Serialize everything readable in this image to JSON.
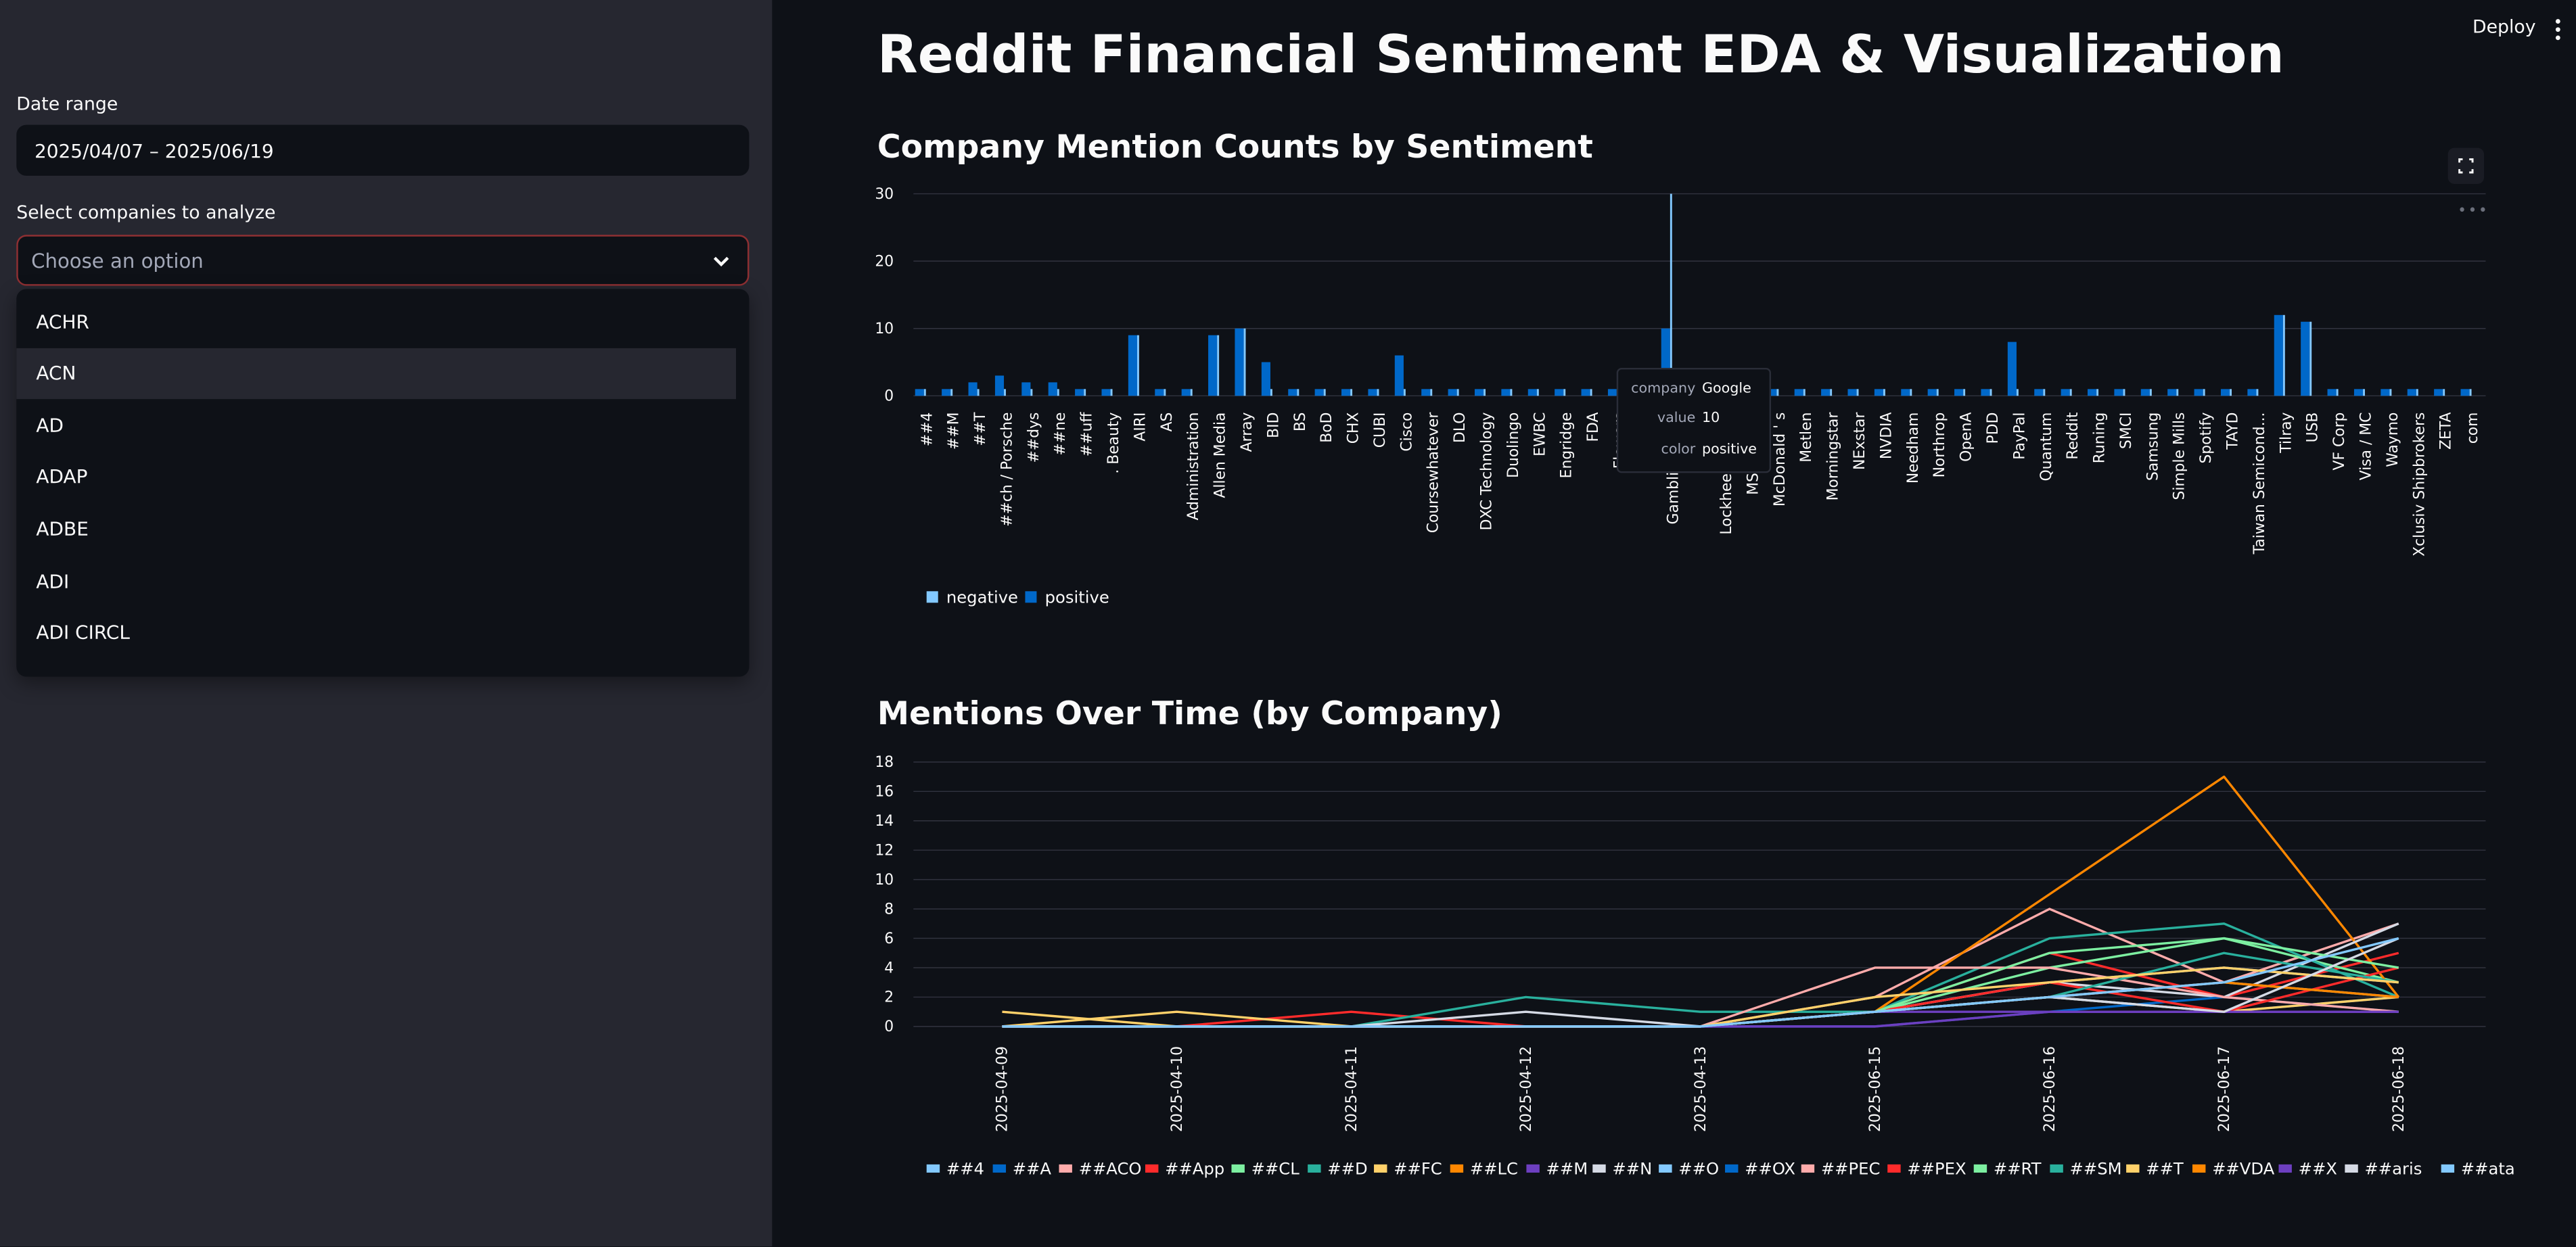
{
  "app": {
    "title": "Reddit Financial Sentiment EDA & Visualization",
    "deploy_label": "Deploy"
  },
  "sidebar": {
    "date_label": "Date range",
    "date_value": "2025/04/07 – 2025/06/19",
    "companies_label": "Select companies to analyze",
    "companies_placeholder": "Choose an option",
    "dropdown_options": [
      "ACHR",
      "ACN",
      "AD",
      "ADAP",
      "ADBE",
      "ADI",
      "ADI CIRCL"
    ],
    "highlighted_option": "ACN"
  },
  "colors": {
    "negative": "#83c9ff",
    "positive": "#0068c9",
    "accent": "#ff4b4b"
  },
  "icons": [
    "chevron-down-icon",
    "fullscreen-icon",
    "more-vert-icon",
    "chart-menu-icon"
  ],
  "bar_section": {
    "heading": "Company Mention Counts by Sentiment",
    "tooltip": {
      "company_key": "company",
      "company_val": "Google",
      "value_key": "value",
      "value_val": "10",
      "color_key": "color",
      "color_val": "positive"
    }
  },
  "line_section": {
    "heading": "Mentions Over Time (by Company)"
  },
  "chart_data": [
    {
      "type": "bar",
      "title": "Company Mention Counts by Sentiment",
      "xlabel": "",
      "ylabel": "",
      "ylim": [
        0,
        30
      ],
      "y_ticks": [
        0,
        10,
        20,
        30
      ],
      "categories": [
        "##4",
        "##M",
        "##T",
        "##ch / Porsche",
        "##dys",
        "##ne",
        "##uff",
        ". Beauty",
        "AIRI",
        "AS",
        "Administration",
        "Allen Media",
        "Array",
        "BID",
        "BS",
        "BoD",
        "CHX",
        "CUBI",
        "Cisco",
        "Coursewhatever",
        "DLO",
        "DXC Technology",
        "Duolingo",
        "EWBC",
        "Engridge",
        "FDA",
        "Flowers",
        "GER",
        "Gambling. com",
        "Gur",
        "Lockheed Martin",
        "MSCI Brazil",
        "McDonald ' s",
        "Metlen",
        "Morningstar",
        "NExstar",
        "NVDIA",
        "Needham",
        "Northrop",
        "OpenA",
        "PDD",
        "PayPal",
        "Quantum",
        "Reddit",
        "Runing",
        "SMCI",
        "Samsung",
        "Simple Mills",
        "Spotify",
        "TAYD",
        "Taiwan Semicond...",
        "Tilray",
        "USB",
        "VF Corp",
        "Visa / MC",
        "Waymo",
        "Xclusiv Shipbrokers",
        "ZETA",
        "com"
      ],
      "series": [
        {
          "name": "negative",
          "values": [
            1,
            1,
            1,
            1,
            1,
            1,
            1,
            1,
            9,
            1,
            1,
            9,
            10,
            1,
            1,
            1,
            1,
            1,
            1,
            1,
            1,
            1,
            1,
            1,
            1,
            1,
            1,
            1,
            30,
            1,
            1,
            1,
            1,
            1,
            1,
            1,
            1,
            1,
            1,
            1,
            1,
            1,
            1,
            1,
            1,
            1,
            1,
            1,
            1,
            1,
            1,
            12,
            11,
            1,
            1,
            1,
            1,
            1,
            1
          ]
        },
        {
          "name": "positive",
          "values": [
            1,
            1,
            2,
            3,
            2,
            2,
            1,
            1,
            9,
            1,
            1,
            9,
            10,
            5,
            1,
            1,
            1,
            1,
            6,
            1,
            1,
            1,
            1,
            1,
            1,
            1,
            1,
            1,
            10,
            1,
            1,
            1,
            1,
            1,
            1,
            1,
            1,
            1,
            1,
            1,
            1,
            8,
            1,
            1,
            1,
            1,
            1,
            1,
            1,
            1,
            1,
            12,
            11,
            1,
            1,
            1,
            1,
            1,
            1
          ]
        }
      ],
      "legend": [
        "negative",
        "positive"
      ],
      "legend_position": "bottom-left",
      "grid": true
    },
    {
      "type": "line",
      "title": "Mentions Over Time (by Company)",
      "xlabel": "",
      "ylabel": "",
      "ylim": [
        0,
        18
      ],
      "y_ticks": [
        0,
        2,
        4,
        6,
        8,
        10,
        12,
        14,
        16,
        18
      ],
      "x": [
        "2025-04-09",
        "2025-04-10",
        "2025-04-11",
        "2025-04-12",
        "2025-04-13",
        "2025-06-15",
        "2025-06-16",
        "2025-06-17",
        "2025-06-18"
      ],
      "series": [
        {
          "name": "##4",
          "color": "#83c9ff",
          "values": [
            0,
            0,
            0,
            0,
            0,
            1,
            3,
            4,
            3
          ]
        },
        {
          "name": "##A",
          "color": "#0068c9",
          "values": [
            0,
            0,
            0,
            0,
            0,
            1,
            2,
            1,
            2
          ]
        },
        {
          "name": "##ACO",
          "color": "#ffabab",
          "values": [
            0,
            0,
            0,
            0,
            0,
            2,
            8,
            3,
            7
          ]
        },
        {
          "name": "##App",
          "color": "#ff2b2b",
          "values": [
            0,
            0,
            1,
            0,
            0,
            1,
            5,
            2,
            5
          ]
        },
        {
          "name": "##CL",
          "color": "#7defa1",
          "values": [
            0,
            0,
            0,
            0,
            0,
            1,
            4,
            6,
            3
          ]
        },
        {
          "name": "##D",
          "color": "#29b09d",
          "values": [
            0,
            0,
            0,
            2,
            1,
            1,
            6,
            7,
            2
          ]
        },
        {
          "name": "##FC",
          "color": "#ffd16a",
          "values": [
            1,
            0,
            0,
            0,
            0,
            1,
            2,
            1,
            2
          ]
        },
        {
          "name": "##LC",
          "color": "#ff8700",
          "values": [
            0,
            0,
            0,
            0,
            0,
            1,
            9,
            17,
            2
          ]
        },
        {
          "name": "##M",
          "color": "#6d3fc0",
          "values": [
            0,
            0,
            0,
            0,
            0,
            1,
            1,
            1,
            1
          ]
        },
        {
          "name": "##N",
          "color": "#d5dae5",
          "values": [
            0,
            0,
            0,
            1,
            0,
            1,
            3,
            2,
            7
          ]
        },
        {
          "name": "##O",
          "color": "#83c9ff",
          "values": [
            0,
            0,
            0,
            0,
            0,
            1,
            2,
            3,
            2
          ]
        },
        {
          "name": "##OX",
          "color": "#0068c9",
          "values": [
            0,
            0,
            0,
            0,
            0,
            0,
            1,
            2,
            1
          ]
        },
        {
          "name": "##PEC",
          "color": "#ffabab",
          "values": [
            0,
            0,
            0,
            0,
            0,
            4,
            4,
            2,
            1
          ]
        },
        {
          "name": "##PEX",
          "color": "#ff2b2b",
          "values": [
            0,
            0,
            0,
            0,
            0,
            1,
            3,
            1,
            4
          ]
        },
        {
          "name": "##RT",
          "color": "#7defa1",
          "values": [
            0,
            0,
            0,
            0,
            0,
            1,
            5,
            6,
            4
          ]
        },
        {
          "name": "##SM",
          "color": "#29b09d",
          "values": [
            0,
            0,
            0,
            0,
            0,
            1,
            2,
            5,
            3
          ]
        },
        {
          "name": "##T",
          "color": "#ffd16a",
          "values": [
            0,
            1,
            0,
            0,
            0,
            2,
            3,
            4,
            3
          ]
        },
        {
          "name": "##VDA",
          "color": "#ff8700",
          "values": [
            0,
            0,
            0,
            0,
            0,
            1,
            2,
            3,
            2
          ]
        },
        {
          "name": "##X",
          "color": "#6d3fc0",
          "values": [
            0,
            0,
            0,
            0,
            0,
            0,
            1,
            1,
            1
          ]
        },
        {
          "name": "##aris",
          "color": "#d5dae5",
          "values": [
            0,
            0,
            0,
            0,
            0,
            1,
            2,
            1,
            6
          ]
        },
        {
          "name": "##ata",
          "color": "#83c9ff",
          "values": [
            0,
            0,
            0,
            0,
            0,
            1,
            2,
            3,
            6
          ]
        }
      ],
      "legend_position": "bottom",
      "grid": true
    }
  ]
}
